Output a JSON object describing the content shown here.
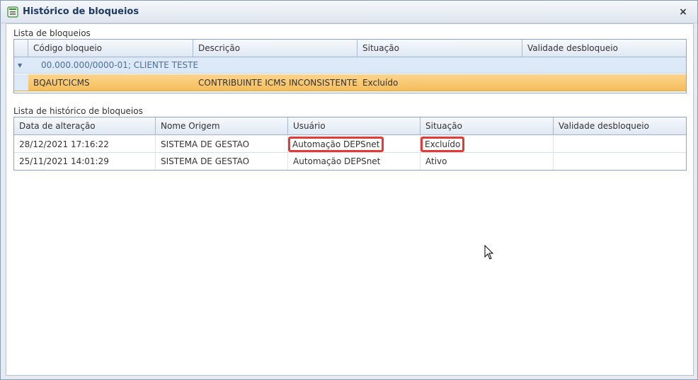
{
  "window": {
    "title": "Histórico de bloqueios",
    "close_label": "×"
  },
  "bloqueios": {
    "section_label": "Lista de bloqueios",
    "columns": [
      "Código bloqueio",
      "Descrição",
      "Situação",
      "Validade desbloqueio"
    ],
    "group_label": "00.000.000/0000-01; CLIENTE TESTE",
    "rows": [
      {
        "codigo": "BQAUTCICMS",
        "descricao": "CONTRIBUINTE ICMS INCONSISTENTE",
        "situacao": "Excluído",
        "validade": ""
      }
    ]
  },
  "historico": {
    "section_label": "Lista de histórico de bloqueios",
    "columns": [
      "Data de alteração",
      "Nome Origem",
      "Usuário",
      "Situação",
      "Validade desbloqueio"
    ],
    "rows": [
      {
        "data": "28/12/2021 17:16:22",
        "origem": "SISTEMA DE GESTAO",
        "usuario": "Automação DEPSnet",
        "situacao": "Excluído",
        "validade": ""
      },
      {
        "data": "25/11/2021 14:01:29",
        "origem": "SISTEMA DE GESTAO",
        "usuario": "Automação DEPSnet",
        "situacao": "Ativo",
        "validade": ""
      }
    ]
  },
  "colors": {
    "selected_row": "#f5be5c",
    "highlight_border": "#e53935",
    "group_text": "#4c6f99"
  },
  "icons": {
    "title": "list-window-icon",
    "group_toggle": "triangle-down-icon",
    "cursor": "mouse-pointer-icon"
  }
}
